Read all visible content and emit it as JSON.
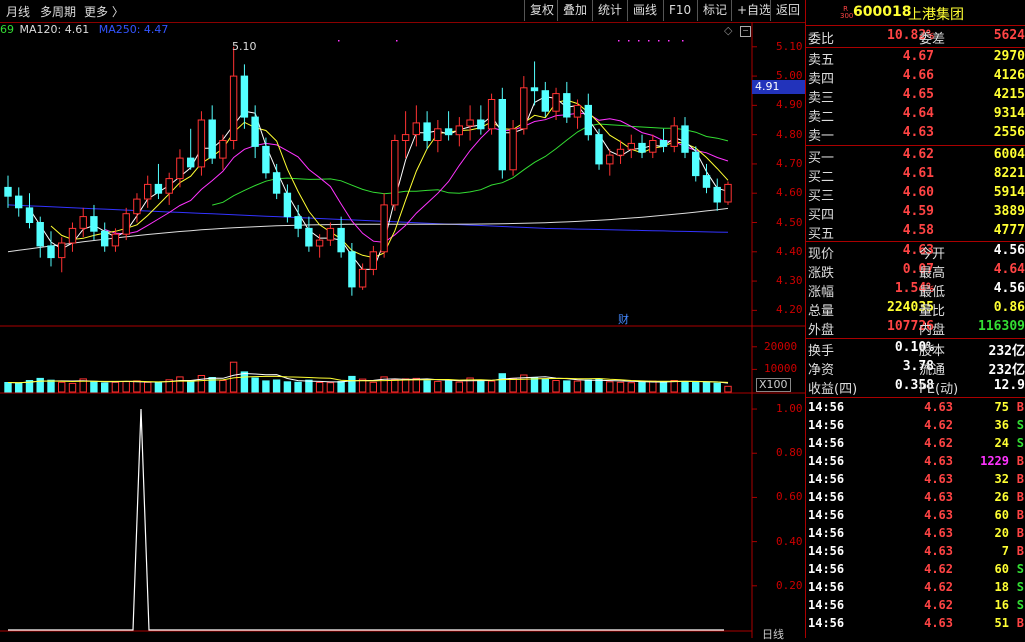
{
  "toolbar": {
    "left": [
      "月线",
      "多周期",
      "更多 〉"
    ],
    "buttons": [
      "复权",
      "叠加",
      "统计",
      "画线",
      "F10",
      "标记",
      "+自选",
      "返回"
    ]
  },
  "ma": {
    "prefix": "69",
    "ma120": "MA120: 4.61",
    "ma250": "MA250: 4.47"
  },
  "annot": {
    "high": "5.10",
    "cai": "财",
    "cursor_price": "4.91"
  },
  "axis": {
    "price_ticks": [
      "5.10",
      "5.00",
      "4.90",
      "4.80",
      "4.70",
      "4.60",
      "4.50",
      "4.40",
      "4.30",
      "4.20"
    ],
    "vol_ticks": [
      "20000",
      "10000"
    ],
    "vol_unit": "X100",
    "ind_ticks": [
      "1.00",
      "0.80",
      "0.60",
      "0.40",
      "0.20"
    ],
    "bottom_label": "日线"
  },
  "quote": {
    "code_badge": "R\n300",
    "code": "600018",
    "name": "上港集团",
    "weibi_label": "委比",
    "weibi": "10.82%",
    "weicha_label": "委差",
    "weicha": "5624",
    "sells": [
      {
        "label": "卖五",
        "price": "4.67",
        "vol": "2970"
      },
      {
        "label": "卖四",
        "price": "4.66",
        "vol": "4126"
      },
      {
        "label": "卖三",
        "price": "4.65",
        "vol": "4215"
      },
      {
        "label": "卖二",
        "price": "4.64",
        "vol": "9314"
      },
      {
        "label": "卖一",
        "price": "4.63",
        "vol": "2556"
      }
    ],
    "buys": [
      {
        "label": "买一",
        "price": "4.62",
        "vol": "6004"
      },
      {
        "label": "买二",
        "price": "4.61",
        "vol": "8221"
      },
      {
        "label": "买三",
        "price": "4.60",
        "vol": "5914"
      },
      {
        "label": "买四",
        "price": "4.59",
        "vol": "3889"
      },
      {
        "label": "买五",
        "price": "4.58",
        "vol": "4777"
      }
    ],
    "stats": [
      {
        "l1": "现价",
        "v1": "4.63",
        "c1": "red",
        "l2": "今开",
        "v2": "4.56",
        "c2": "wht"
      },
      {
        "l1": "涨跌",
        "v1": "0.07",
        "c1": "red",
        "l2": "最高",
        "v2": "4.64",
        "c2": "red"
      },
      {
        "l1": "涨幅",
        "v1": "1.54%",
        "c1": "red",
        "l2": "最低",
        "v2": "4.56",
        "c2": "wht"
      },
      {
        "l1": "总量",
        "v1": "224035",
        "c1": "yel",
        "l2": "量比",
        "v2": "0.86",
        "c2": "yel"
      },
      {
        "l1": "外盘",
        "v1": "107726",
        "c1": "red",
        "l2": "内盘",
        "v2": "116309",
        "c2": "grn"
      }
    ],
    "stats2": [
      {
        "l1": "换手",
        "v1": "0.10%",
        "c1": "wht",
        "l2": "股本",
        "v2": "232亿",
        "c2": "wht"
      },
      {
        "l1": "净资",
        "v1": "3.78",
        "c1": "wht",
        "l2": "流通",
        "v2": "232亿",
        "c2": "wht"
      },
      {
        "l1": "收益(四)",
        "v1": "0.358",
        "c1": "wht",
        "l2": "PE(动)",
        "v2": "12.9",
        "c2": "wht"
      }
    ],
    "ticks": [
      {
        "t": "14:56",
        "p": "4.63",
        "v": "75",
        "d": "B"
      },
      {
        "t": "14:56",
        "p": "4.62",
        "v": "36",
        "d": "S"
      },
      {
        "t": "14:56",
        "p": "4.62",
        "v": "24",
        "d": "S"
      },
      {
        "t": "14:56",
        "p": "4.63",
        "v": "1229",
        "d": "B"
      },
      {
        "t": "14:56",
        "p": "4.63",
        "v": "32",
        "d": "B"
      },
      {
        "t": "14:56",
        "p": "4.63",
        "v": "26",
        "d": "B"
      },
      {
        "t": "14:56",
        "p": "4.63",
        "v": "60",
        "d": "B"
      },
      {
        "t": "14:56",
        "p": "4.63",
        "v": "20",
        "d": "B"
      },
      {
        "t": "14:56",
        "p": "4.63",
        "v": "7",
        "d": "B"
      },
      {
        "t": "14:56",
        "p": "4.62",
        "v": "60",
        "d": "S"
      },
      {
        "t": "14:56",
        "p": "4.62",
        "v": "18",
        "d": "S"
      },
      {
        "t": "14:56",
        "p": "4.62",
        "v": "16",
        "d": "S"
      },
      {
        "t": "14:56",
        "p": "4.63",
        "v": "51",
        "d": "B"
      }
    ]
  },
  "colors": {
    "up": "#ff3333",
    "down": "#54ffff",
    "ma1": "#ffffff",
    "ma2": "#ffff33",
    "ma3": "#ff33ff",
    "ma4": "#33dd33",
    "ma120": "#dddddd",
    "ma250": "#3333ff"
  },
  "chart_data": {
    "type": "candlestick",
    "y_range": [
      4.15,
      5.13
    ],
    "candles": [
      [
        4.62,
        4.66,
        4.55,
        4.59
      ],
      [
        4.59,
        4.62,
        4.52,
        4.55
      ],
      [
        4.55,
        4.6,
        4.48,
        4.5
      ],
      [
        4.5,
        4.52,
        4.38,
        4.42
      ],
      [
        4.42,
        4.47,
        4.35,
        4.38
      ],
      [
        4.38,
        4.45,
        4.33,
        4.43
      ],
      [
        4.43,
        4.5,
        4.4,
        4.48
      ],
      [
        4.48,
        4.55,
        4.45,
        4.52
      ],
      [
        4.52,
        4.56,
        4.44,
        4.47
      ],
      [
        4.47,
        4.5,
        4.4,
        4.42
      ],
      [
        4.42,
        4.48,
        4.4,
        4.46
      ],
      [
        4.46,
        4.55,
        4.44,
        4.53
      ],
      [
        4.53,
        4.6,
        4.5,
        4.58
      ],
      [
        4.58,
        4.66,
        4.55,
        4.63
      ],
      [
        4.63,
        4.7,
        4.58,
        4.6
      ],
      [
        4.6,
        4.67,
        4.56,
        4.65
      ],
      [
        4.65,
        4.75,
        4.62,
        4.72
      ],
      [
        4.72,
        4.82,
        4.68,
        4.69
      ],
      [
        4.69,
        4.88,
        4.66,
        4.85
      ],
      [
        4.85,
        4.9,
        4.7,
        4.72
      ],
      [
        4.72,
        4.8,
        4.68,
        4.78
      ],
      [
        4.78,
        5.1,
        4.75,
        5.0
      ],
      [
        5.0,
        5.04,
        4.82,
        4.86
      ],
      [
        4.86,
        4.9,
        4.72,
        4.76
      ],
      [
        4.76,
        4.79,
        4.65,
        4.67
      ],
      [
        4.67,
        4.7,
        4.58,
        4.6
      ],
      [
        4.6,
        4.63,
        4.5,
        4.52
      ],
      [
        4.52,
        4.56,
        4.45,
        4.48
      ],
      [
        4.48,
        4.52,
        4.4,
        4.42
      ],
      [
        4.42,
        4.46,
        4.38,
        4.44
      ],
      [
        4.44,
        4.5,
        4.42,
        4.48
      ],
      [
        4.48,
        4.52,
        4.38,
        4.4
      ],
      [
        4.4,
        4.43,
        4.25,
        4.28
      ],
      [
        4.28,
        4.36,
        4.27,
        4.34
      ],
      [
        4.34,
        4.42,
        4.32,
        4.4
      ],
      [
        4.4,
        4.6,
        4.38,
        4.56
      ],
      [
        4.56,
        4.8,
        4.54,
        4.78
      ],
      [
        4.78,
        4.88,
        4.72,
        4.8
      ],
      [
        4.8,
        4.9,
        4.76,
        4.84
      ],
      [
        4.84,
        4.88,
        4.75,
        4.78
      ],
      [
        4.78,
        4.85,
        4.74,
        4.82
      ],
      [
        4.82,
        4.88,
        4.78,
        4.8
      ],
      [
        4.8,
        4.86,
        4.76,
        4.83
      ],
      [
        4.83,
        4.9,
        4.78,
        4.85
      ],
      [
        4.85,
        4.9,
        4.8,
        4.82
      ],
      [
        4.82,
        4.94,
        4.8,
        4.92
      ],
      [
        4.92,
        4.96,
        4.65,
        4.68
      ],
      [
        4.68,
        4.85,
        4.66,
        4.82
      ],
      [
        4.82,
        5.0,
        4.8,
        4.96
      ],
      [
        4.96,
        5.05,
        4.9,
        4.95
      ],
      [
        4.95,
        4.98,
        4.86,
        4.88
      ],
      [
        4.88,
        4.96,
        4.85,
        4.94
      ],
      [
        4.94,
        4.98,
        4.84,
        4.86
      ],
      [
        4.86,
        4.92,
        4.82,
        4.9
      ],
      [
        4.9,
        4.94,
        4.78,
        4.8
      ],
      [
        4.8,
        4.82,
        4.68,
        4.7
      ],
      [
        4.7,
        4.75,
        4.66,
        4.73
      ],
      [
        4.73,
        4.78,
        4.7,
        4.75
      ],
      [
        4.75,
        4.8,
        4.72,
        4.77
      ],
      [
        4.77,
        4.8,
        4.72,
        4.74
      ],
      [
        4.74,
        4.8,
        4.72,
        4.78
      ],
      [
        4.78,
        4.82,
        4.74,
        4.76
      ],
      [
        4.76,
        4.86,
        4.74,
        4.83
      ],
      [
        4.83,
        4.86,
        4.72,
        4.74
      ],
      [
        4.74,
        4.76,
        4.64,
        4.66
      ],
      [
        4.66,
        4.7,
        4.6,
        4.62
      ],
      [
        4.62,
        4.65,
        4.54,
        4.57
      ],
      [
        4.57,
        4.64,
        4.56,
        4.63
      ]
    ],
    "volumes": [
      4200,
      3900,
      5100,
      6000,
      5200,
      4300,
      3800,
      5800,
      4700,
      4000,
      4300,
      4600,
      4900,
      4300,
      4100,
      5400,
      6700,
      4900,
      7300,
      6400,
      5100,
      13200,
      8900,
      6200,
      4900,
      5300,
      4500,
      4300,
      5200,
      4200,
      4100,
      4600,
      6900,
      5700,
      4300,
      6700,
      5400,
      5800,
      6000,
      5000,
      4700,
      4800,
      4400,
      6200,
      5200,
      4800,
      8100,
      6000,
      7500,
      6400,
      5800,
      5100,
      4900,
      4800,
      5300,
      5700,
      4500,
      4300,
      4100,
      4400,
      4800,
      4500,
      5100,
      4600,
      4400,
      4300,
      3900,
      2500
    ],
    "indicator": {
      "spike_index": 5,
      "spike_value": 1.0,
      "y_range": [
        0,
        1.05
      ]
    }
  }
}
